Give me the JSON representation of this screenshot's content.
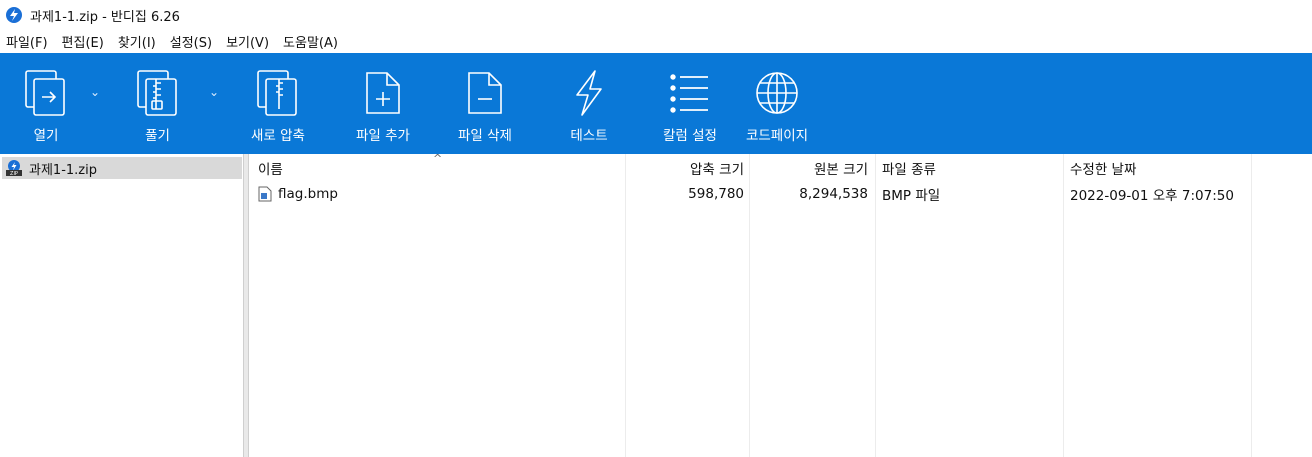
{
  "window": {
    "title": "과제1-1.zip - 반디집 6.26"
  },
  "menu": [
    "파일(F)",
    "편집(E)",
    "찾기(I)",
    "설정(S)",
    "보기(V)",
    "도움말(A)"
  ],
  "toolbar": {
    "open": "열기",
    "extract": "풀기",
    "new_archive": "새로 압축",
    "add_file": "파일 추가",
    "delete_file": "파일 삭제",
    "test": "테스트",
    "columns": "칼럼 설정",
    "codepage": "코드페이지",
    "accent_color": "#0a78d7"
  },
  "tree": {
    "archive": "과제1-1.zip"
  },
  "columns": {
    "name": "이름",
    "compressed": "압축 크기",
    "original": "원본 크기",
    "type": "파일 종류",
    "modified": "수정한 날짜"
  },
  "files": [
    {
      "name": "flag.bmp",
      "compressed": "598,780",
      "original": "8,294,538",
      "type": "BMP 파일",
      "modified": "2022-09-01 오후 7:07:50",
      "icon": "bitmap-file-icon"
    }
  ]
}
